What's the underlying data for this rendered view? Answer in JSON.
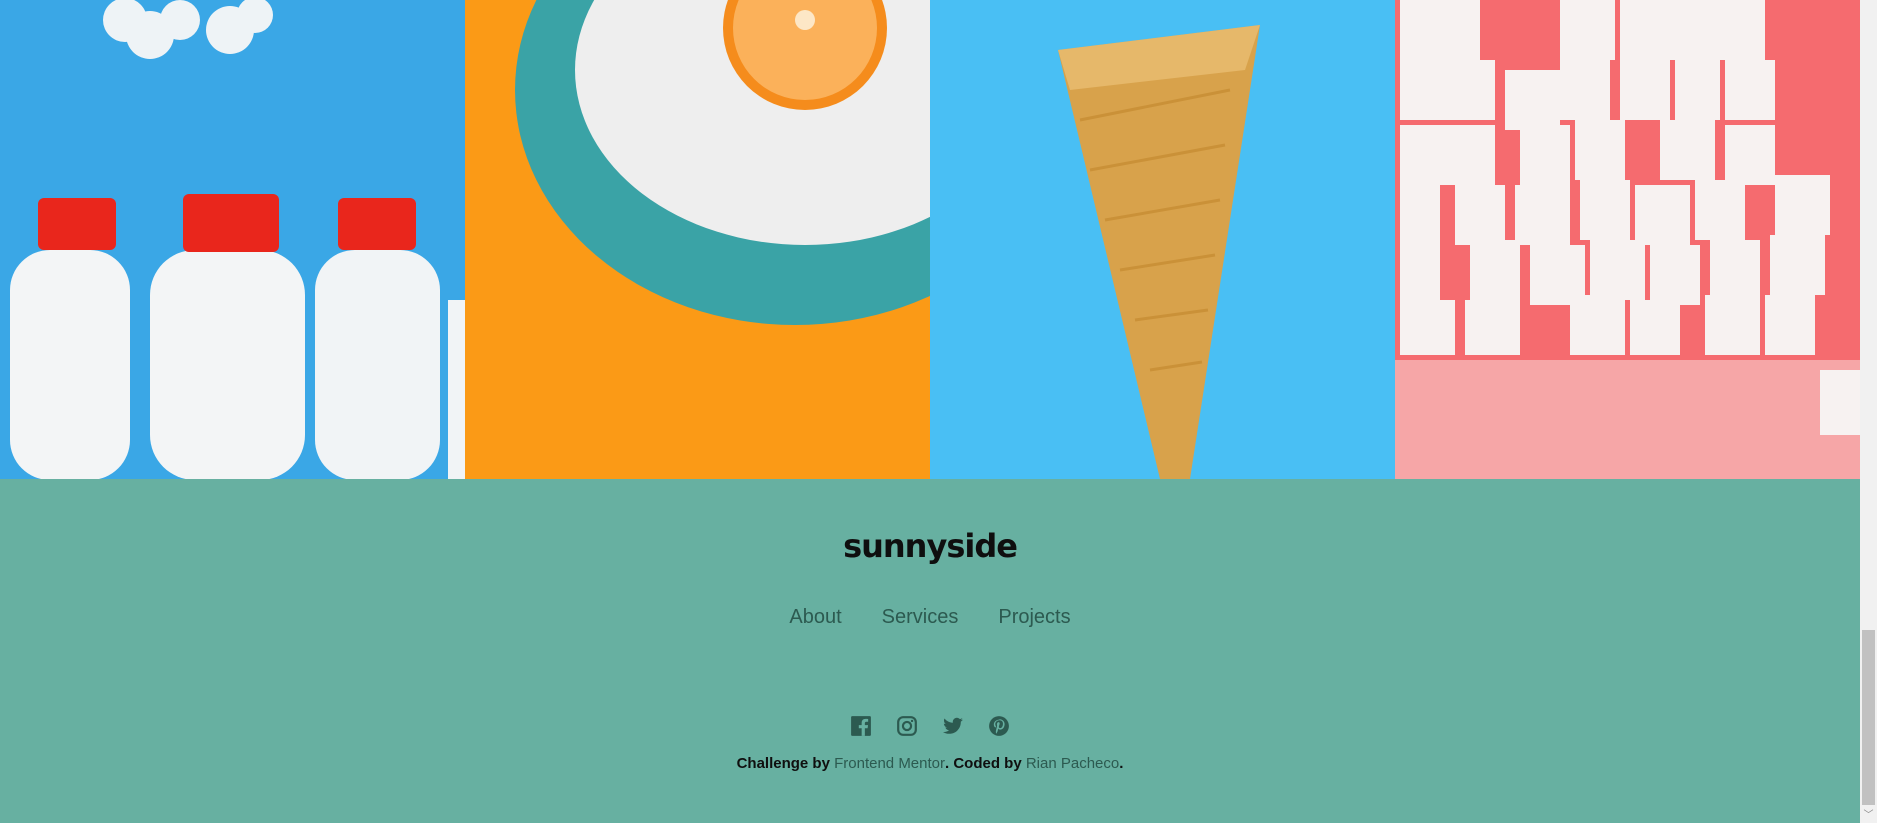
{
  "gallery": {
    "images": [
      {
        "name": "milk-bottles-image",
        "bg": "#3aa7e6"
      },
      {
        "name": "orange-bowl-image",
        "bg": "#fb9a16"
      },
      {
        "name": "ice-cream-cone-image",
        "bg": "#49bff4"
      },
      {
        "name": "sugar-cubes-image",
        "bg": "#f56b6f"
      }
    ]
  },
  "footer": {
    "logo": "sunnyside",
    "nav": [
      "About",
      "Services",
      "Projects"
    ],
    "social_icons": [
      "facebook-icon",
      "instagram-icon",
      "twitter-icon",
      "pinterest-icon"
    ],
    "attribution": {
      "prefix": "Challenge by ",
      "link1": "Frontend Mentor",
      "middle": ". Coded by ",
      "link2": "Rian Pacheco",
      "suffix": "."
    },
    "colors": {
      "background": "#67b0a1",
      "link": "#2c5a50"
    }
  },
  "scrollbar": {
    "arrow": "﹀"
  }
}
